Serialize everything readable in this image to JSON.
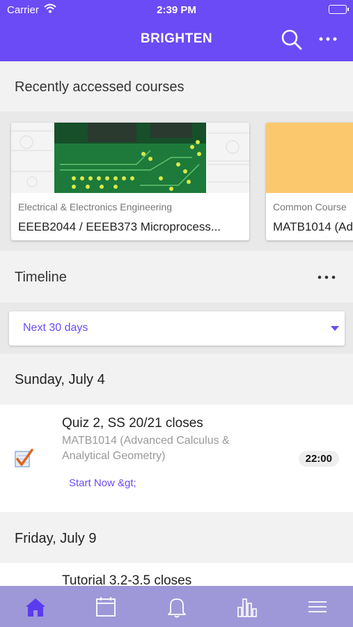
{
  "status": {
    "carrier": "Carrier",
    "time": "2:39 PM"
  },
  "header": {
    "title": "BRIGHTEN",
    "search_icon": "search-icon",
    "more_icon": "more-horizontal-icon"
  },
  "recent": {
    "title": "Recently accessed courses",
    "courses": [
      {
        "category": "Electrical & Electronics Engineering",
        "name": "EEEB2044 / EEEB373 Microprocess...",
        "thumb": "circuit-board-image"
      },
      {
        "category": "Common Course",
        "name": "MATB1014 (Ad",
        "thumb_color": "#fcc86e"
      }
    ]
  },
  "timeline": {
    "title": "Timeline",
    "filter": "Next 30 days",
    "days": [
      {
        "date": "Sunday, July 4",
        "events": [
          {
            "title": "Quiz 2, SS 20/21 closes",
            "course": "MATB1014 (Advanced Calculus & Analytical Geometry)",
            "time": "22:00",
            "action": "Start Now &gt;",
            "icon": "quiz-checkmark-icon"
          }
        ]
      },
      {
        "date": "Friday, July 9",
        "events": [
          {
            "title": "Tutorial 3.2-3.5 closes"
          }
        ]
      }
    ]
  },
  "tabs": [
    "home-icon",
    "calendar-icon",
    "bell-icon",
    "bar-chart-icon",
    "menu-icon"
  ],
  "colors": {
    "accent": "#6b4bf5",
    "tabbar": "#9f98d8"
  }
}
